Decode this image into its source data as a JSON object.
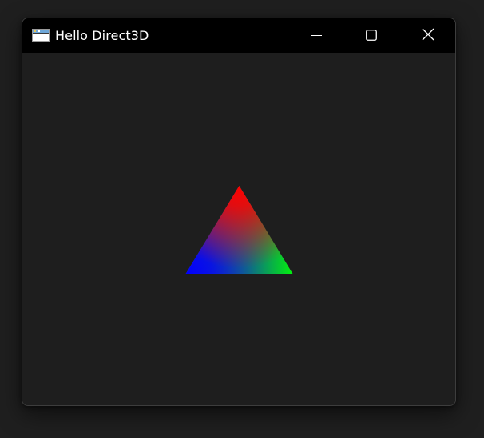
{
  "window": {
    "title": "Hello Direct3D",
    "icon": "app-window-icon",
    "controls": [
      "minimize-icon",
      "maximize-icon",
      "close-icon"
    ]
  },
  "scene": {
    "shape": "triangle",
    "vertex_colors": {
      "top": "#ff0000",
      "bottom_left": "#0000ff",
      "bottom_right": "#00ff00"
    },
    "clear_color": "#1e1e1e"
  },
  "theme": {
    "titlebar_bg": "#000000",
    "title_fg": "#ffffff",
    "border": "#3d3d3d"
  }
}
